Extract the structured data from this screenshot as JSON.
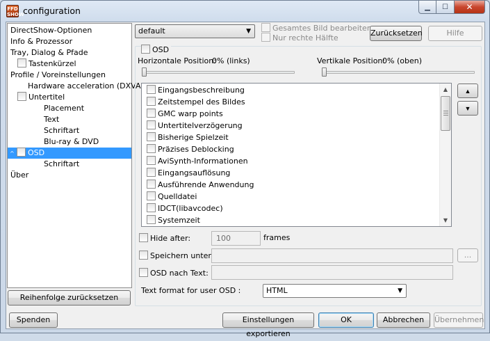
{
  "window": {
    "icon_text": "FFD\nSHOW",
    "title": "configuration",
    "minimize_symbol": "▁",
    "maximize_symbol": "☐",
    "close_symbol": "✕"
  },
  "tree": {
    "items": [
      {
        "label": "DirectShow-Optionen"
      },
      {
        "label": "Info & Prozessor"
      },
      {
        "label": "Tray, Dialog & Pfade"
      },
      {
        "label": "Tastenkürzel",
        "checkbox": true
      },
      {
        "label": "Profile / Voreinstellungen"
      },
      {
        "label": "Hardware acceleration (DXVA)"
      },
      {
        "label": "Untertitel",
        "checkbox": true
      },
      {
        "label": "Placement"
      },
      {
        "label": "Text"
      },
      {
        "label": "Schriftart"
      },
      {
        "label": "Blu-ray & DVD"
      },
      {
        "label": "OSD",
        "checkbox": true,
        "selected": true,
        "expander": "^"
      },
      {
        "label": "Schriftart"
      },
      {
        "label": "Über"
      }
    ]
  },
  "buttons": {
    "reset_order": "Reihenfolge zurücksetzen",
    "donate": "Spenden",
    "export": "Einstellungen exportieren",
    "ok": "OK",
    "cancel": "Abbrechen",
    "apply": "Übernehmen",
    "reset": "Zurücksetzen",
    "help": "Hilfe",
    "browse": "...",
    "move_up": "▲",
    "move_down": "▼"
  },
  "preset": {
    "value": "default",
    "arrow": "▼"
  },
  "top_options": {
    "whole_image": "Gesamtes Bild bearbeiten",
    "right_half": "Nur rechte Hälfte"
  },
  "osd": {
    "enable_label": "OSD",
    "horizontal_position_label": "Horizontale Position:",
    "horizontal_position_value": "0% (links)",
    "horizontal_position": 0,
    "vertical_position_label": "Vertikale Position:",
    "vertical_position_value": "0% (oben)",
    "vertical_position": 0,
    "items": [
      "Eingangsbeschreibung",
      "Zeitstempel des Bildes",
      "GMC warp points",
      "Untertitelverzögerung",
      "Bisherige Spielzeit",
      "Präzises Deblocking",
      "AviSynth-Informationen",
      "Eingangsauflösung",
      "Ausführende Anwendung",
      "Quelldatei",
      "IDCT(libavcodec)",
      "Systemzeit"
    ],
    "hide_after_label": "Hide after:",
    "hide_after_value": "100",
    "frames_label": "frames",
    "save_to_label": "Speichern unter:",
    "osd_to_text_label": "OSD nach Text:",
    "text_format_label": "Text format for user OSD :",
    "text_format_value": "HTML"
  },
  "scroll_arrows": {
    "up": "▲",
    "down": "▼"
  }
}
